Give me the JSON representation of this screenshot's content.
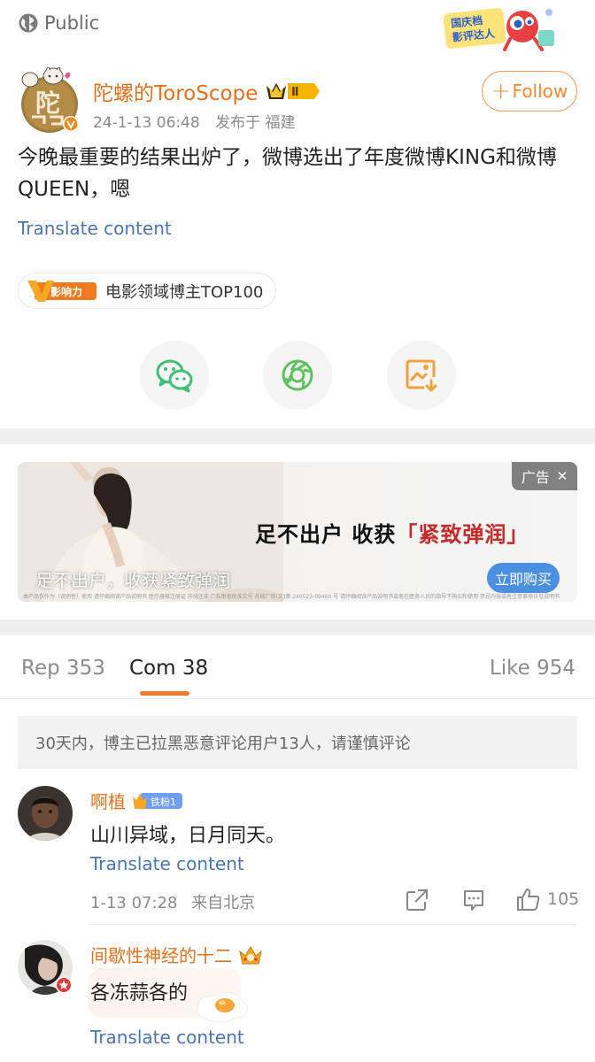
{
  "header": {
    "visibility": "Public",
    "event_badge_line1": "国庆档",
    "event_badge_line2": "影评达人"
  },
  "post": {
    "author_name": "陀螺的ToroScope",
    "vip_level": "Ⅱ",
    "date": "24-1-13 06:48",
    "location": "发布于 福建",
    "follow_label": "Follow",
    "text": "今晚最重要的结果出炉了，微博选出了年度微博KING和微博QUEEN，嗯",
    "translate_label": "Translate content",
    "tag_badge": "影响力",
    "tag_label": "电影领域博主TOP100"
  },
  "share": {
    "items": [
      {
        "name": "wechat-icon",
        "color": "#3fbf74"
      },
      {
        "name": "moments-icon",
        "color": "#5fc15b"
      },
      {
        "name": "save-image-icon",
        "color": "#f0a23a"
      }
    ]
  },
  "ad": {
    "tag": "广告",
    "headline": "足不出户  收获",
    "headline_highlight": "「紧致弹润」",
    "caption": "足不出户，收获紧致弹润",
    "button": "立即购买",
    "fine_print": "本产品仅作为（说明性）使用 请仔细阅读产品说明书 医疗器械注册证 苏械注准 广告审查批准文号 苏械广审(文)第 240523-09460 号 请仔细阅读产品说明书或者在医务人员的指导下购买和使用 禁忌内容或者注意事项详见说明书"
  },
  "tabs": {
    "reposts": "Rep 353",
    "comments": "Com 38",
    "likes": "Like 954"
  },
  "notice": "30天内，博主已拉黑恶意评论用户13人，请谨慎评论",
  "comments": [
    {
      "name": "啊植",
      "badge": "铁粉1",
      "text": "山川异域，日月同天。",
      "translate": "Translate content",
      "date": "1-13 07:28",
      "location": "来自北京",
      "likes": "105"
    },
    {
      "name": "间歇性神经的十二",
      "text": "各冻蒜各的",
      "translate": "Translate content"
    }
  ],
  "colors": {
    "accent": "#e2711d",
    "link": "#4a76b0",
    "ad_button": "#4a8fe0"
  }
}
